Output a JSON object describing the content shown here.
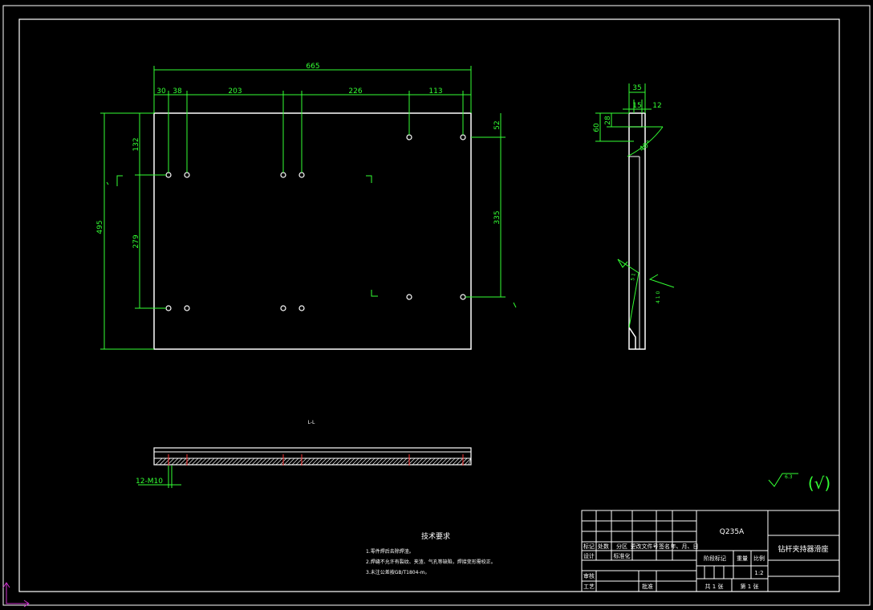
{
  "colors": {
    "background": "#000000",
    "outline": "#ffffff",
    "dimension": "#33ff33",
    "hole": "#ffffff",
    "section_mark": "#ff3333",
    "ucs": "#cc33cc"
  },
  "top_view": {
    "overall_width": "665",
    "segments": [
      "30",
      "38",
      "203",
      "226",
      "113"
    ],
    "overall_height": "495",
    "row_offset": "132",
    "row_spacing": "279",
    "right_offset": "52",
    "right_spacing": "335"
  },
  "side_view": {
    "width": "35",
    "inner": "15",
    "lip": "12",
    "height_a": "60",
    "height_b": "28",
    "chamfer": "40°",
    "weld_note_a": "5 1",
    "weld_note_b": "4 1 0"
  },
  "section_view": {
    "label": "12-M10",
    "section_mark": "L-L"
  },
  "surface_finish": {
    "symbol_value": "6.3",
    "general": "(√)"
  },
  "technical_requirements": {
    "title": "技术要求",
    "items": [
      "1.零件焊后去除焊渣。",
      "2.焊缝不允许有裂纹、夹渣、气孔等缺陷，焊接变形需校正。",
      "3.未注公差按GB/T1804-m。"
    ]
  },
  "title_block": {
    "material": "Q235A",
    "part_name": "钻杆夹持器滑座",
    "scale": "1:2",
    "cells": {
      "mark": "标记",
      "count": "处数",
      "zone": "分区",
      "change_doc": "更改文件号",
      "sign": "签名",
      "date": "年、月、日",
      "design": "设计",
      "standardize": "标准化",
      "stage_mark": "阶段标记",
      "weight": "重量",
      "ratio": "比例",
      "review": "审核",
      "process": "工艺",
      "approve": "批准",
      "sheet_total": "共 1 张",
      "sheet_no": "第 1 张"
    }
  }
}
